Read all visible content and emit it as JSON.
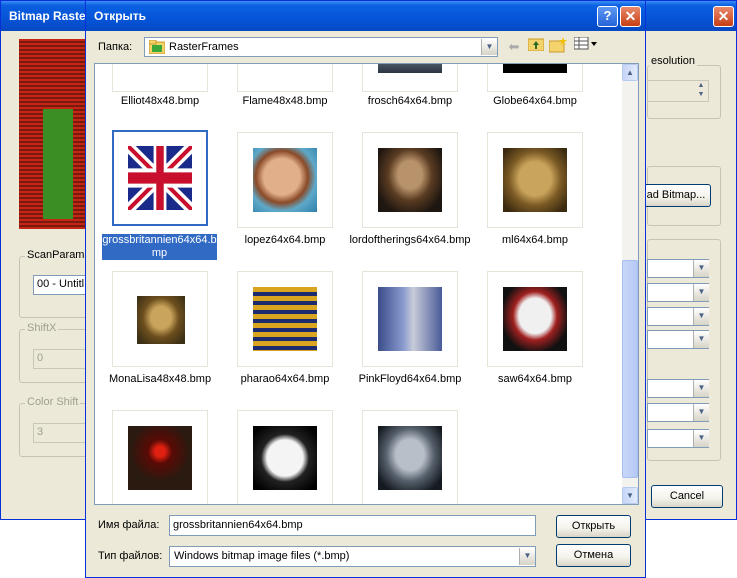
{
  "background_window": {
    "title": "Bitmap Raste",
    "resolution_label": "esolution",
    "scan_params_label": "ScanParame",
    "scan_params_value": "00 - Untitl",
    "shiftx_label": "ShiftX",
    "shiftx_value": "0",
    "color_shift_label": "Color Shift",
    "color_shift_value": "3",
    "load_bitmap_label": "ad Bitmap...",
    "cancel_label": "Cancel",
    "close_glyph": "✕"
  },
  "dialog": {
    "title": "Открыть",
    "help_glyph": "?",
    "close_glyph": "✕",
    "folder_label": "Папка:",
    "folder_value": "RasterFrames",
    "toolbar_icons": [
      "back-arrow-icon",
      "up-folder-icon",
      "new-folder-icon",
      "views-menu-icon"
    ],
    "files_row0": [
      "Elliot48x48.bmp",
      "Flame48x48.bmp",
      "frosch64x64.bmp",
      "Globe64x64.bmp"
    ],
    "files_row1": [
      "grossbritannien64x64.bmp",
      "lopez64x64.bmp",
      "lordoftherings64x64.bmp",
      "ml64x64.bmp"
    ],
    "files_row2": [
      "MonaLisa48x48.bmp",
      "pharao64x64.bmp",
      "PinkFloyd64x64.bmp",
      "saw64x64.bmp"
    ],
    "selected_caption_line1": "grossbritannien64x64.b",
    "selected_caption_line2": "mp",
    "filename_label": "Имя файла:",
    "filename_value": "grossbritannien64x64.bmp",
    "filetype_label": "Тип файлов:",
    "filetype_value": "Windows bitmap image files (*.bmp)",
    "open_label": "Открыть",
    "cancel_label": "Отмена"
  },
  "colors": {
    "selection": "#316ac5",
    "title_bar": "#0554d8",
    "dialog_bg": "#ece9d8"
  }
}
